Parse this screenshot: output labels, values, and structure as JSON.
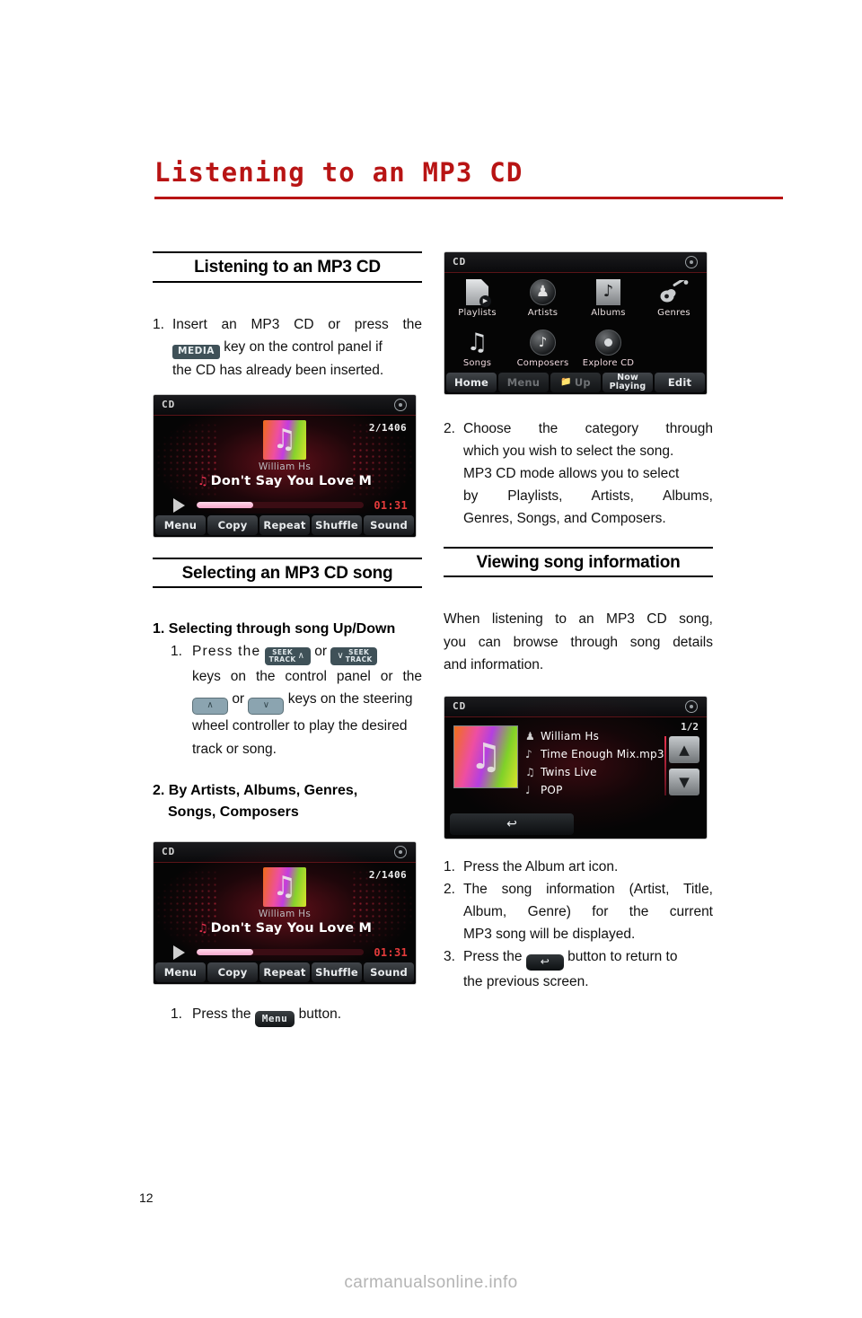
{
  "page": {
    "title": "Listening to an MP3 CD",
    "number": "12",
    "watermark": "carmanualsonline.info"
  },
  "left_column": {
    "section1": {
      "heading": "Listening to an MP3 CD",
      "step1_part1": "1.",
      "step1_text_a": "Insert an MP3 CD or press the",
      "media_key": "MEDIA",
      "step1_text_b": "key on the control panel if",
      "step1_text_c": "the CD has already been inserted."
    },
    "section2": {
      "heading": "Selecting an MP3 CD song",
      "sub1_heading": "1. Selecting through song Up/Down",
      "sub1_num": "1.",
      "sub1_text_a": "Press the",
      "seek_up": {
        "line1": "SEEK",
        "line2": "TRACK",
        "caret": "∧"
      },
      "or_1": "or",
      "seek_down": {
        "line1": "SEEK",
        "line2": "TRACK",
        "caret": "∨"
      },
      "sub1_text_b": "keys on the control panel or the",
      "wheel_up": "∧",
      "or_2": "or",
      "wheel_down": "∨",
      "sub1_text_c": "keys on the steering",
      "sub1_text_d": "wheel controller to play the desired",
      "sub1_text_e": "track or song.",
      "sub2_heading_line1": "2. By Artists, Albums, Genres,",
      "sub2_heading_line2": "Songs, Composers",
      "sub2_num": "1.",
      "sub2_text_a": "Press the",
      "menu_key": "Menu",
      "sub2_text_b": "button."
    }
  },
  "right_column": {
    "step2": {
      "num": "2.",
      "line1": "Choose the category through",
      "line2": "which you  wish to select the song.",
      "line3": "MP3 CD mode allows you to select",
      "line4": "by Playlists, Artists, Albums,",
      "line5": "Genres, Songs, and Composers."
    },
    "section3": {
      "heading": "Viewing song information",
      "intro_line1": "When listening to an MP3 CD song,",
      "intro_line2": "you can browse through song details",
      "intro_line3": "and information.",
      "steps": [
        {
          "num": "1.",
          "text": "Press the Album art icon."
        },
        {
          "num": "2.",
          "text_line1": "The song information (Artist, Title,",
          "text_line2": "Album,   Genre) for the current",
          "text_line3": "MP3 song will be displayed."
        },
        {
          "num": "3.",
          "text_a": "Press the",
          "return_key": "↩",
          "text_b": "button to return to",
          "text_c": "the previous screen."
        }
      ]
    }
  },
  "screens": {
    "now_playing": {
      "source_label": "CD",
      "disc_icon": "disc-icon",
      "track_count": "2/1406",
      "artist": "William Hs",
      "song_title": "Don't Say You Love M",
      "music_note": "♫",
      "elapsed_time": "01:31",
      "progress_percent": 34,
      "softkeys": [
        "Menu",
        "Copy",
        "Repeat",
        "Shuffle",
        "Sound"
      ]
    },
    "category_menu": {
      "source_label": "CD",
      "disc_icon": "disc-icon",
      "row1": [
        {
          "label": "Playlists",
          "icon": "playlist-doc-icon"
        },
        {
          "label": "Artists",
          "icon": "person-circle-icon"
        },
        {
          "label": "Albums",
          "icon": "album-note-icon"
        },
        {
          "label": "Genres",
          "icon": "guitar-icon"
        }
      ],
      "row2": [
        {
          "label": "Songs",
          "icon": "double-note-icon"
        },
        {
          "label": "Composers",
          "icon": "baton-circle-icon"
        },
        {
          "label": "Explore CD",
          "icon": "disc-circle-icon"
        }
      ],
      "softkeys": [
        {
          "label": "Home",
          "dim": false
        },
        {
          "label": "Menu",
          "dim": true
        },
        {
          "label": "Up",
          "dim": true,
          "icon": "folder-up-icon"
        },
        {
          "label": "Now\nPlaying",
          "dim": false,
          "two_line": true
        },
        {
          "label": "Edit",
          "dim": false
        }
      ]
    },
    "song_info": {
      "source_label": "CD",
      "disc_icon": "disc-icon",
      "page_indicator": "1/2",
      "rows": [
        {
          "icon": "person-icon",
          "glyph": "♟",
          "text": "William Hs"
        },
        {
          "icon": "note-icon",
          "glyph": "♪",
          "text": "Time Enough Mix.mp3"
        },
        {
          "icon": "album-icon",
          "glyph": "♫",
          "text": "Twins Live"
        },
        {
          "icon": "guitar-icon",
          "glyph": "♩",
          "text": "POP"
        }
      ],
      "scroll_up": "▲",
      "scroll_down": "▼",
      "back_button": "↩"
    }
  },
  "colors": {
    "title_red": "#b81414",
    "chip_slate": "#3f5158",
    "wheel_blue": "#8ba4b0",
    "screen_red": "#e8304f"
  }
}
